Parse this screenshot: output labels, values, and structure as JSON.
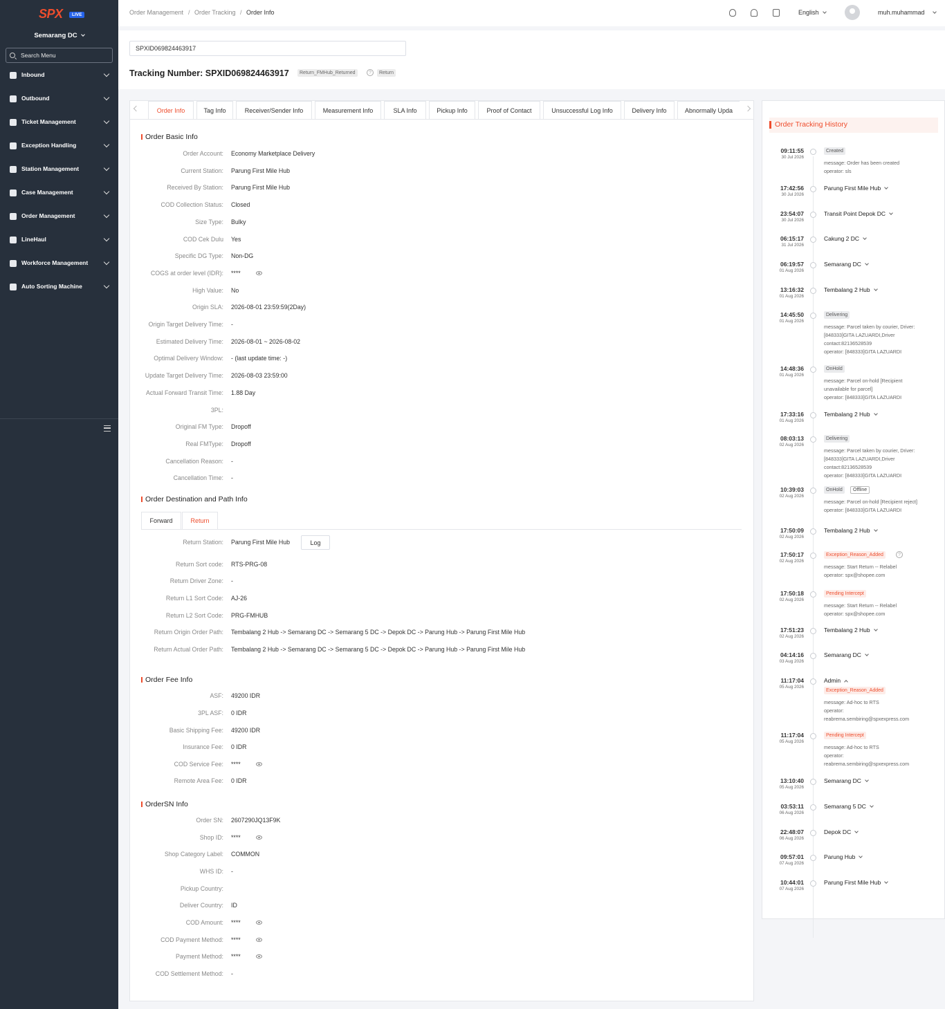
{
  "sidebar": {
    "logo": "SPX",
    "live_badge": "LIVE",
    "station": "Semarang DC",
    "search_placeholder": "Search Menu",
    "items": [
      "Inbound",
      "Outbound",
      "Ticket Management",
      "Exception Handling",
      "Station Management",
      "Case Management",
      "Order Management",
      "LineHaul",
      "Workforce Management",
      "Auto Sorting Machine"
    ]
  },
  "topbar": {
    "breadcrumb": [
      "Order Management",
      "Order Tracking",
      "Order Info"
    ],
    "language": "English",
    "user": "muh.muhammad"
  },
  "header": {
    "tracking_input": "SPXID069824463917",
    "title": "Tracking Number: SPXID069824463917",
    "status_tag": "Return_FMHub_Returned",
    "return_tag": "Return"
  },
  "tabs": [
    "Order Info",
    "Tag Info",
    "Receiver/Sender Info",
    "Measurement Info",
    "SLA Info",
    "Pickup Info",
    "Proof of Contact",
    "Unsuccessful Log Info",
    "Delivery Info",
    "Abnormally Upda"
  ],
  "basic_info": {
    "title": "Order Basic Info",
    "rows": [
      {
        "label": "Order Account:",
        "value": "Economy Marketplace Delivery"
      },
      {
        "label": "Current Station:",
        "value": "Parung First Mile Hub"
      },
      {
        "label": "Received By Station:",
        "value": "Parung First Mile Hub"
      },
      {
        "label": "COD Collection Status:",
        "value": "Closed"
      },
      {
        "label": "Size Type:",
        "value": "Bulky"
      },
      {
        "label": "COD Cek Dulu",
        "value": "Yes"
      },
      {
        "label": "Specific DG Type:",
        "value": "Non-DG"
      },
      {
        "label": "COGS at order level (IDR):",
        "value": "****",
        "masked": true
      },
      {
        "label": "High Value:",
        "value": "No"
      },
      {
        "label": "Origin SLA:",
        "value": "2026-08-01 23:59:59(2Day)"
      },
      {
        "label": "Origin Target Delivery Time:",
        "value": "-"
      },
      {
        "label": "Estimated Delivery Time:",
        "value": "2026-08-01 ~ 2026-08-02"
      },
      {
        "label": "Optimal Delivery Window:",
        "value": "- (last update time: -)"
      },
      {
        "label": "Update Target Delivery Time:",
        "value": "2026-08-03 23:59:00"
      },
      {
        "label": "Actual Forward Transit Time:",
        "value": "1.88 Day"
      },
      {
        "label": "3PL:",
        "value": ""
      },
      {
        "label": "Original FM Type:",
        "value": "Dropoff"
      },
      {
        "label": "Real FMType:",
        "value": "Dropoff"
      },
      {
        "label": "Cancellation Reason:",
        "value": "-"
      },
      {
        "label": "Cancellation Time:",
        "value": "-"
      }
    ]
  },
  "destination": {
    "title": "Order Destination and Path Info",
    "subtabs": [
      "Forward",
      "Return"
    ],
    "log_button": "Log",
    "rows": [
      {
        "label": "Return Station:",
        "value": "Parung First Mile Hub"
      },
      {
        "label": "Return Sort code:",
        "value": "RTS-PRG-08"
      },
      {
        "label": "Return Driver Zone:",
        "value": "-"
      },
      {
        "label": "Return L1 Sort Code:",
        "value": "AJ-26"
      },
      {
        "label": "Return L2 Sort Code:",
        "value": "PRG-FMHUB"
      },
      {
        "label": "Return Origin Order Path:",
        "value": "Tembalang 2 Hub  -> Semarang DC  -> Semarang 5 DC  -> Depok DC  -> Parung Hub  -> Parung First Mile Hub"
      },
      {
        "label": "Return Actual Order Path:",
        "value": "Tembalang 2 Hub  -> Semarang DC  -> Semarang 5 DC  -> Depok DC  -> Parung Hub  -> Parung First Mile Hub"
      }
    ]
  },
  "fee_info": {
    "title": "Order Fee Info",
    "rows": [
      {
        "label": "ASF:",
        "value": "49200 IDR"
      },
      {
        "label": "3PL ASF:",
        "value": "0 IDR"
      },
      {
        "label": "Basic Shipping Fee:",
        "value": "49200 IDR"
      },
      {
        "label": "Insurance Fee:",
        "value": "0 IDR"
      },
      {
        "label": "COD Service Fee:",
        "value": "****",
        "masked": true
      },
      {
        "label": "Remote Area Fee:",
        "value": "0 IDR"
      }
    ]
  },
  "ordersn_info": {
    "title": "OrderSN Info",
    "rows": [
      {
        "label": "Order SN:",
        "value": "2607290JQ13F9K"
      },
      {
        "label": "Shop ID:",
        "value": "****",
        "masked": true
      },
      {
        "label": "Shop Category Label:",
        "value": "COMMON"
      },
      {
        "label": "WHS ID:",
        "value": "-"
      },
      {
        "label": "Pickup Country:",
        "value": ""
      },
      {
        "label": "Deliver Country:",
        "value": "ID"
      },
      {
        "label": "COD Amount:",
        "value": "****",
        "masked": true
      },
      {
        "label": "COD Payment Method:",
        "value": "****",
        "masked": true
      },
      {
        "label": "Payment Method:",
        "value": "****",
        "masked": true
      },
      {
        "label": "COD Settlement Method:",
        "value": "-"
      }
    ]
  },
  "history": {
    "title": "Order Tracking History",
    "events": [
      {
        "time": "09:11:55",
        "date": "30 Jul 2026",
        "tag": "Created",
        "msg": [
          "message: Order has been created",
          "operator: sls"
        ]
      },
      {
        "time": "17:42:56",
        "date": "30 Jul 2026",
        "station": "Parung First Mile Hub"
      },
      {
        "time": "23:54:07",
        "date": "30 Jul 2026",
        "station": "Transit Point Depok DC"
      },
      {
        "time": "06:15:17",
        "date": "31 Jul 2026",
        "station": "Cakung 2 DC"
      },
      {
        "time": "06:19:57",
        "date": "01 Aug 2026",
        "station": "Semarang DC"
      },
      {
        "time": "13:16:32",
        "date": "01 Aug 2026",
        "station": "Tembalang 2 Hub"
      },
      {
        "time": "14:45:50",
        "date": "01 Aug 2026",
        "tag": "Delivering",
        "msg": [
          "message: Parcel taken by courier, Driver:",
          "[848333]GITA LAZUARDI,Driver",
          "contact:82136528539",
          "operator: [848333]GITA LAZUARDI"
        ]
      },
      {
        "time": "14:48:36",
        "date": "01 Aug 2026",
        "tag": "OnHold",
        "msg": [
          "message: Parcel on-hold [Recipient",
          "unavailable for parcel]",
          "operator: [848333]GITA LAZUARDI"
        ]
      },
      {
        "time": "17:33:16",
        "date": "01 Aug 2026",
        "station": "Tembalang 2 Hub"
      },
      {
        "time": "08:03:13",
        "date": "02 Aug 2026",
        "tag": "Delivering",
        "msg": [
          "message: Parcel taken by courier, Driver:",
          "[848333]GITA LAZUARDI,Driver",
          "contact:82136528539",
          "operator: [848333]GITA LAZUARDI"
        ]
      },
      {
        "time": "10:39:03",
        "date": "02 Aug 2026",
        "tag": "OnHold",
        "tag2": "Offline",
        "msg": [
          "message: Parcel on-hold [Recipient reject]",
          "operator: [848333]GITA LAZUARDI"
        ]
      },
      {
        "time": "17:50:09",
        "date": "02 Aug 2026",
        "station": "Tembalang 2 Hub"
      },
      {
        "time": "17:50:17",
        "date": "02 Aug 2026",
        "tag": "Exception_Reason_Added",
        "red": true,
        "help": true,
        "msg": [
          "message: Start Return -- Relabel",
          "operator: spx@shopee.com"
        ]
      },
      {
        "time": "17:50:18",
        "date": "02 Aug 2026",
        "tag": "Pending Intercept",
        "red": true,
        "msg": [
          "message: Start Return -- Relabel",
          "operator: spx@shopee.com"
        ]
      },
      {
        "time": "17:51:23",
        "date": "02 Aug 2026",
        "station": "Tembalang 2 Hub"
      },
      {
        "time": "04:14:16",
        "date": "03 Aug 2026",
        "station": "Semarang DC"
      },
      {
        "time": "11:17:04",
        "date": "05 Aug 2026",
        "station": "Admin",
        "expanded": true,
        "tag": "Exception_Reason_Added",
        "red": true,
        "msg": [
          "message: Ad-hoc to RTS",
          "operator:",
          "reabrema.sembiring@spxexpress.com"
        ]
      },
      {
        "time": "11:17:04",
        "date": "05 Aug 2026",
        "tag": "Pending Intercept",
        "red": true,
        "msg": [
          "message: Ad-hoc to RTS",
          "operator:",
          "reabrema.sembiring@spxexpress.com"
        ]
      },
      {
        "time": "13:10:40",
        "date": "05 Aug 2026",
        "station": "Semarang DC"
      },
      {
        "time": "03:53:11",
        "date": "06 Aug 2026",
        "station": "Semarang 5 DC"
      },
      {
        "time": "22:48:07",
        "date": "06 Aug 2026",
        "station": "Depok DC"
      },
      {
        "time": "09:57:01",
        "date": "07 Aug 2026",
        "station": "Parung Hub"
      },
      {
        "time": "10:44:01",
        "date": "07 Aug 2026",
        "station": "Parung First Mile Hub"
      }
    ]
  },
  "colors": {
    "accent": "#ee4d2d",
    "sidebar": "#27303c",
    "live": "#2563eb"
  }
}
